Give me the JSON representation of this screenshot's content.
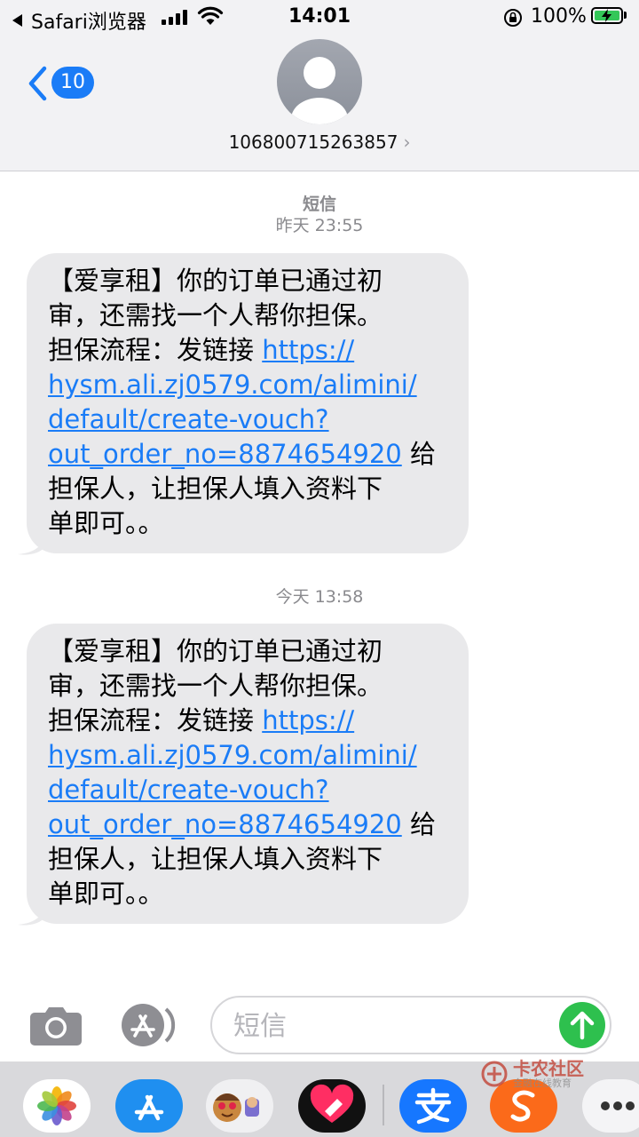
{
  "status_bar": {
    "back_app": "Safari浏览器",
    "time": "14:01",
    "battery": "100%",
    "battery_level": 1.0,
    "signal_bars": 4
  },
  "header": {
    "unread_count": "10",
    "contact": "106800715263857"
  },
  "messages": [
    {
      "service": "短信",
      "timestamp": "昨天 23:55",
      "lines": [
        {
          "text": "【爱享租】你的订单已通过初"
        },
        {
          "text": "审，还需找一个人帮你担保。"
        },
        {
          "text": "担保流程：发链接 ",
          "link": "https://"
        },
        {
          "link": "hysm.ali.zj0579.com/alimini/"
        },
        {
          "link": "default/create-vouch?"
        },
        {
          "link": "out_order_no=8874654920",
          "text": " 给"
        },
        {
          "text": "担保人，让担保人填入资料下"
        },
        {
          "text": "单即可。。"
        }
      ]
    },
    {
      "timestamp": "今天 13:58",
      "lines": [
        {
          "text": "【爱享租】你的订单已通过初"
        },
        {
          "text": "审，还需找一个人帮你担保。"
        },
        {
          "text": "担保流程：发链接 ",
          "link": "https://"
        },
        {
          "link": "hysm.ali.zj0579.com/alimini/"
        },
        {
          "link": "default/create-vouch?"
        },
        {
          "link": "out_order_no=8874654920",
          "text": " 给"
        },
        {
          "text": "担保人，让担保人填入资料下"
        },
        {
          "text": "单即可。。"
        }
      ]
    }
  ],
  "input": {
    "placeholder": "短信"
  },
  "watermark": {
    "title": "卡农社区",
    "subtitle": "金融在线教育"
  },
  "colors": {
    "accent": "#1a7cf7",
    "bubble": "#e9e9eb",
    "send": "#2ec04e",
    "battery": "#34c759"
  }
}
